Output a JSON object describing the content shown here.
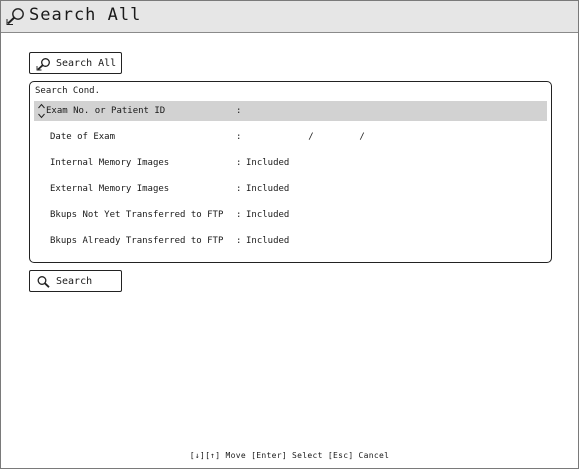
{
  "window": {
    "title": "Search All",
    "icon": "search-magnifier-icon"
  },
  "toolbar": {
    "search_all_label": "Search All"
  },
  "search_conditions": {
    "title": "Search Cond.",
    "rows": [
      {
        "label": "Exam No. or Patient ID",
        "value": "",
        "selected": true
      },
      {
        "label": "Date of Exam",
        "value": "   /    /"
      },
      {
        "label": "Internal Memory Images",
        "value": "Included"
      },
      {
        "label": "External Memory Images",
        "value": "Included"
      },
      {
        "label": "Bkups Not Yet Transferred to FTP",
        "value": "Included"
      },
      {
        "label": "Bkups Already Transferred to FTP",
        "value": "Included"
      }
    ]
  },
  "actions": {
    "search_label": "Search"
  },
  "footer": {
    "hint": "[↓][↑] Move  [Enter] Select  [Esc] Cancel"
  }
}
